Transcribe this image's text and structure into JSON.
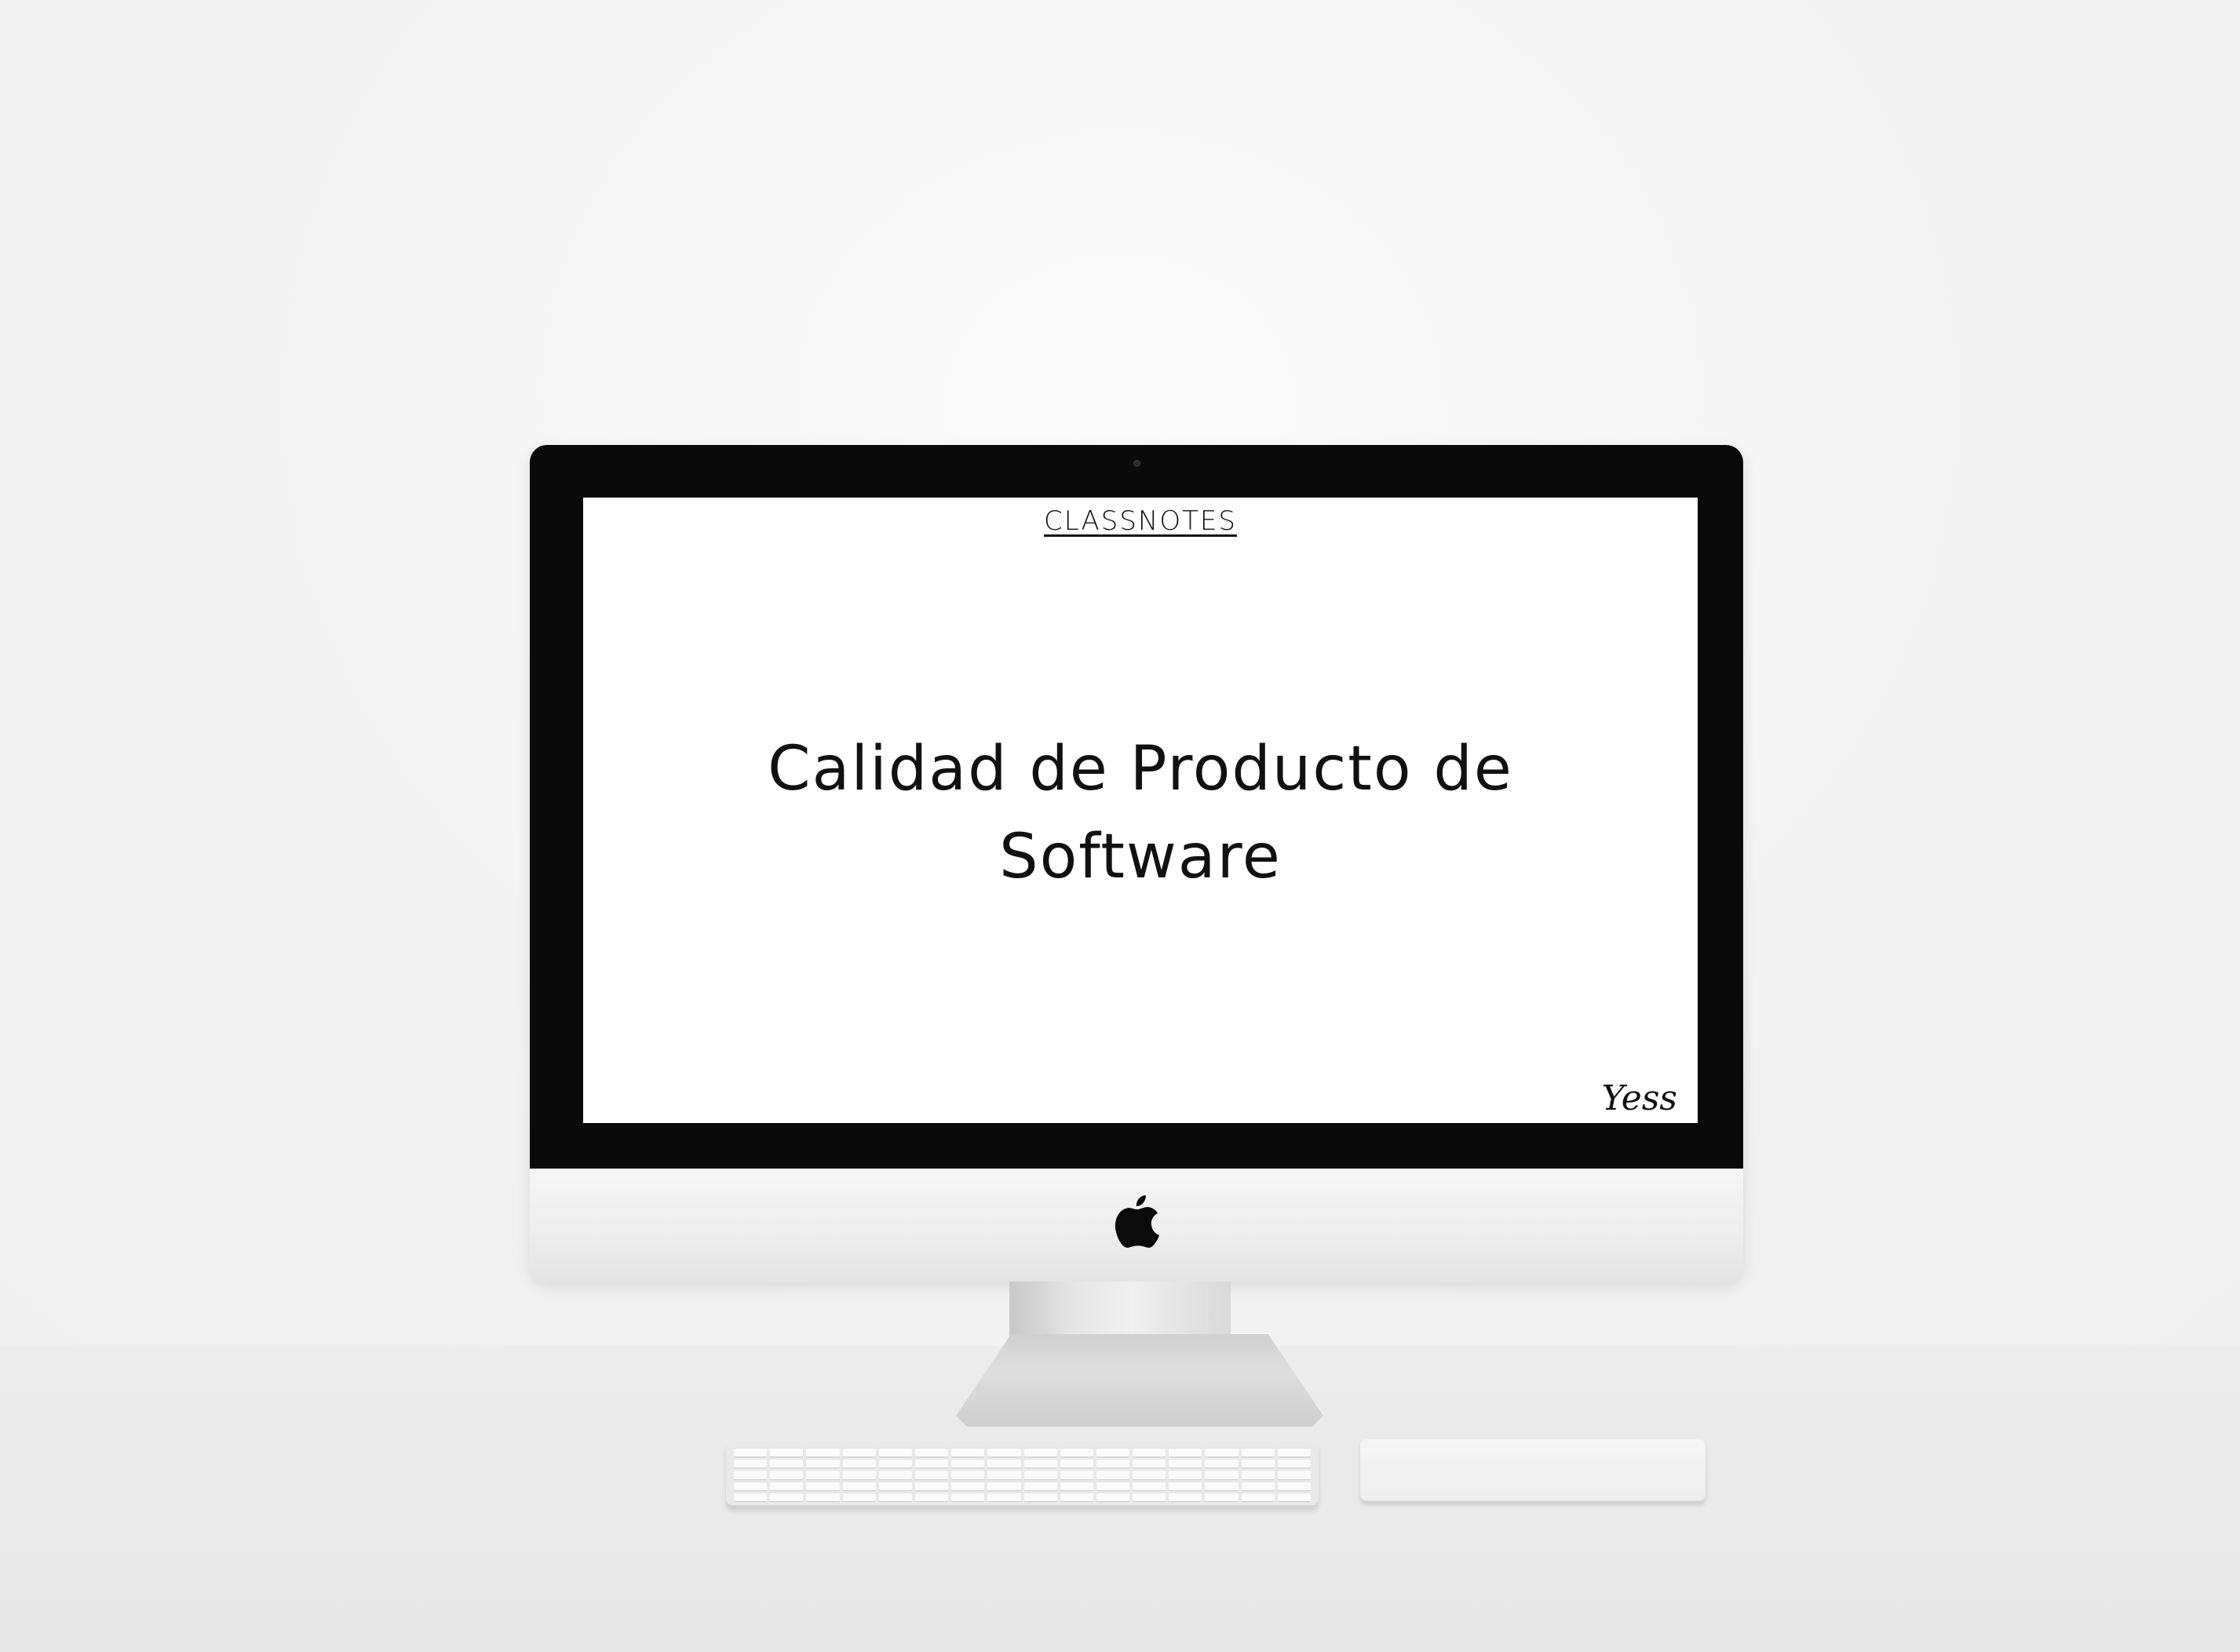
{
  "screen": {
    "site_name": "CLASSNOTES",
    "title": "Calidad de Producto de Software",
    "signature": "Yess"
  },
  "device": {
    "logo_icon": "apple-logo-icon",
    "keyboard_keys": 80
  },
  "colors": {
    "bezel": "#0a0a0a",
    "screen_bg": "#ffffff",
    "text": "#111111",
    "background": "#f2f2f2"
  }
}
